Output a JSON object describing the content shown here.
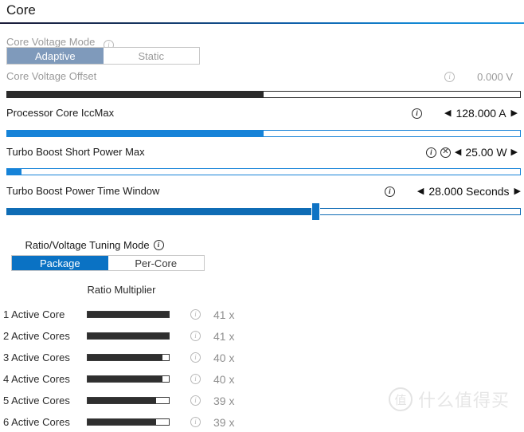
{
  "header": {
    "title": "Core"
  },
  "voltage": {
    "mode_label": "Core Voltage Mode",
    "mode_options": [
      {
        "label": "Adaptive",
        "selected": true
      },
      {
        "label": "Static",
        "selected": false
      }
    ],
    "offset_label": "Core Voltage Offset",
    "offset_value": "0.000 V",
    "offset_fill_percent": 50
  },
  "iccmax": {
    "label": "Processor Core IccMax",
    "value": "128.000 A",
    "left_arrow": "◀",
    "right_arrow": "▶",
    "fill_percent": 50
  },
  "short_power": {
    "label": "Turbo Boost Short Power Max",
    "value": "25.00 W",
    "left_arrow": "◀",
    "right_arrow": "▶",
    "fill_percent": 3
  },
  "time_window": {
    "label": "Turbo Boost Power Time Window",
    "value": "28.000 Seconds",
    "left_arrow": "◀",
    "right_arrow": "▶",
    "fill_percent": 60
  },
  "tuning": {
    "mode_label": "Ratio/Voltage Tuning Mode",
    "mode_options": [
      {
        "label": "Package",
        "selected": true
      },
      {
        "label": "Per-Core",
        "selected": false
      }
    ],
    "ratio_title": "Ratio Multiplier",
    "rows": [
      {
        "label": "1 Active Core",
        "value": "41 x",
        "fill_percent": 100
      },
      {
        "label": "2 Active Cores",
        "value": "41 x",
        "fill_percent": 100
      },
      {
        "label": "3 Active Cores",
        "value": "40 x",
        "fill_percent": 92
      },
      {
        "label": "4 Active Cores",
        "value": "40 x",
        "fill_percent": 92
      },
      {
        "label": "5 Active Cores",
        "value": "39 x",
        "fill_percent": 84
      },
      {
        "label": "6 Active Cores",
        "value": "39 x",
        "fill_percent": 84
      }
    ]
  },
  "icons": {
    "info": "i",
    "reset": "✕",
    "watermark_badge": "值"
  },
  "watermark": {
    "text": "什么值得买"
  },
  "colors": {
    "accent_blue": "#0a72c4",
    "disabled_blue": "#7f9abb",
    "track_blue": "#1683d8",
    "dark": "#2b2b2b",
    "dim_text": "#9a9a9a"
  }
}
